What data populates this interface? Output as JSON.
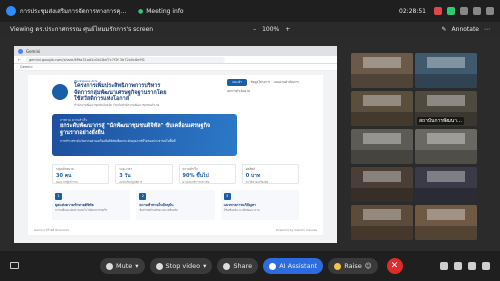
{
  "window": {
    "title": "การประชุมส่งเสริมการจัดการทางการคุณธรรมวาระการ",
    "meeting_info": "Meeting info",
    "time": "02:28:51"
  },
  "view_bar": {
    "viewing": "Viewing ดร.ประกาศกรรณ ศุนย์ไหมมรักการ's screen",
    "zoom": "100%",
    "zoom_plus": "+",
    "zoom_minus": "–",
    "annotate": "Annotate"
  },
  "browser": {
    "url": "gemini.google.com/share/6f9a31ad2c0b18ef7c7f3f 3b72a0c8e9f1",
    "site_label": "Gemini"
  },
  "page": {
    "tag": "Workspace Arts",
    "title": "โครงการเพิ่มประสิทธิภาพการบริหารจัดการกลุ่มพัฒนาเศรษฐกิจฐานรากโดยใช้สวัสดิการแห่งโอกาส",
    "subtitle": "สำนักงานพัฒนาชุมชนจังหวัด ร่วมกับสำนักงานพัฒนาชุมชนอำเภอ",
    "primary_action": "แนะนำ",
    "action_2": "ข้อมูลโครงการ",
    "action_3": "แผนงานดำเนินการ",
    "action_4": "ผลการดำเนินงาน",
    "banner_tag": "ภาพรวม ความสำเร็จ",
    "banner_title": "ยกระดับพัฒนากรสู่ \"นักพัฒนาชุมชนดิจิทัล\" ขับเคลื่อนเศรษฐกิจฐานรากอย่างยั่งยืน",
    "banner_desc": "การสร้างสรรค์นวัตกรรมผ่านเครื่องมือดิจิทัลเพื่อยกระดับคุณภาพชีวิตของประชาชนในพื้นที่",
    "stats": [
      {
        "label": "กลุ่มเป้าหมาย",
        "value": "30 คน",
        "desc": "พัฒนากรผู้เข้าร่วม"
      },
      {
        "label": "ระยะเวลา",
        "value": "3 วัน",
        "desc": "อบรมเชิงปฏิบัติการ"
      },
      {
        "label": "ความสำเร็จ",
        "value": "90% ขึ้นไป",
        "desc": "ผ่านเกณฑ์การประเมิน"
      },
      {
        "label": "ผลลัพธ์",
        "value": "0 บาท",
        "desc": "ค่าใช้จ่ายเครื่องมือ"
      }
    ],
    "cards": [
      {
        "num": "1",
        "title": "ยุคแห่งความท้าทายดิจิทัล",
        "desc": "การเปลี่ยนแปลงทางเทคโนโลยีอย่างรวดเร็ว"
      },
      {
        "num": "2",
        "title": "ความท้าทายในปัจจุบัน",
        "desc": "ข้อจำกัดด้านทักษะและเครื่องมือ"
      },
      {
        "num": "3",
        "title": "แนวทางการแก้ปัญหา",
        "desc": "ใช้เครื่องมือ AI เพื่อพัฒนางาน"
      }
    ],
    "footer_left": "Gemini สร้างด้วย Gemini",
    "footer_right": "Powered by Gemini Canvas"
  },
  "gallery": {
    "tiles": [
      {
        "label": "",
        "color": "#6b5a4a"
      },
      {
        "label": "",
        "color": "#3f5a6e"
      },
      {
        "label": "",
        "color": "#5a4e3c"
      },
      {
        "label": "สถาบันการพัฒนา...",
        "color": "#4e4a40"
      },
      {
        "label": "",
        "color": "#5d5b55"
      },
      {
        "label": "",
        "color": "#6a6862"
      },
      {
        "label": "",
        "color": "#4a3e36"
      },
      {
        "label": "",
        "color": "#3a3a48"
      },
      {
        "label": "",
        "color": "#5c4a3a"
      },
      {
        "label": "",
        "color": "#6e5a44"
      }
    ]
  },
  "controls": {
    "mute": "Mute",
    "stop_video": "Stop video",
    "share": "Share",
    "ai_assistant": "AI Assistant",
    "raise": "Raise",
    "end": "✕"
  },
  "colors": {
    "accent": "#2d6cdf",
    "end": "#e02b2b",
    "brand": "#1a5ea8"
  }
}
